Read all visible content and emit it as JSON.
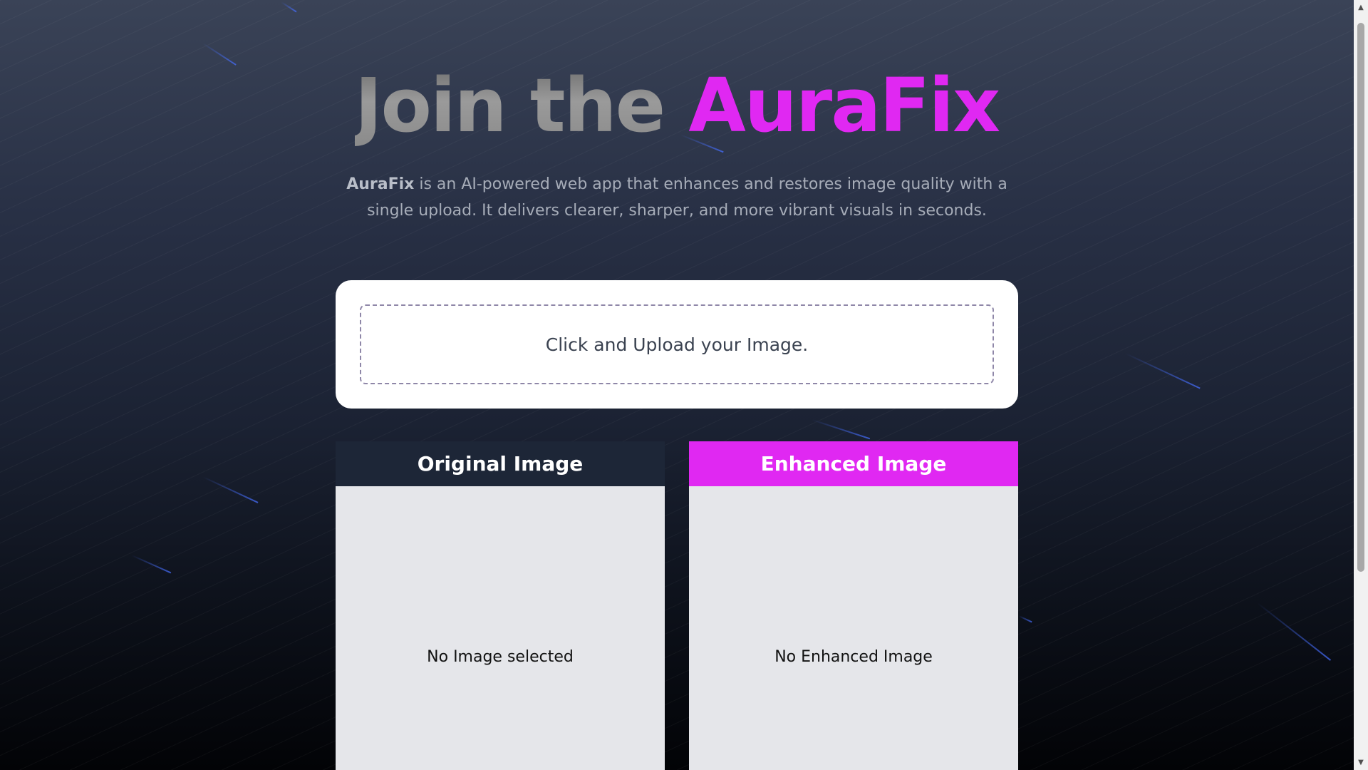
{
  "hero": {
    "title_prefix": "Join the ",
    "title_brand": "AuraFix",
    "intro_brand": "AuraFix",
    "intro_text": " is an AI-powered web app that enhances and restores image quality with a single upload. It delivers clearer, sharper, and more vibrant visuals in seconds."
  },
  "upload": {
    "label": "Click and Upload your Image."
  },
  "panels": {
    "original": {
      "header": "Original Image",
      "empty_text": "No Image selected"
    },
    "enhanced": {
      "header": "Enhanced Image",
      "empty_text": "No Enhanced Image"
    }
  },
  "colors": {
    "accent": "#e028f2",
    "panel_dark": "#1d2637",
    "panel_body": "#e5e6ea"
  },
  "icons": {
    "scroll_up": "▲",
    "scroll_down": "▼"
  }
}
